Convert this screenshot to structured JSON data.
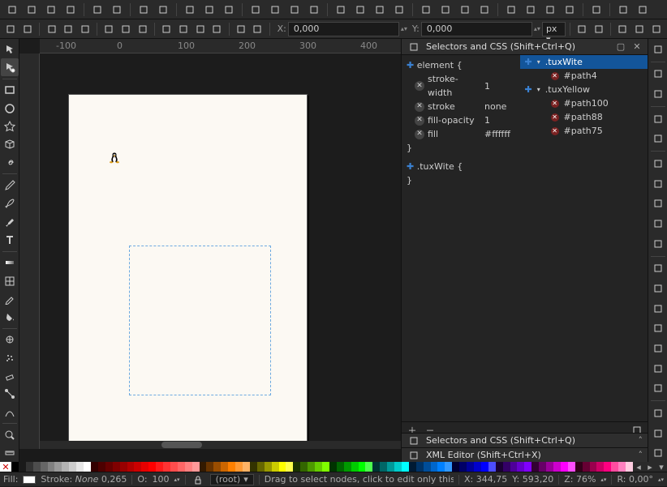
{
  "toolbar1": {
    "groups": [
      [
        "new-document-icon",
        "open-icon",
        "save-icon",
        "print-icon"
      ],
      [
        "import-icon",
        "export-icon"
      ],
      [
        "undo-icon",
        "redo-icon"
      ],
      [
        "copy-icon",
        "cut-icon",
        "paste-icon"
      ],
      [
        "zoom-in-icon",
        "zoom-out-icon",
        "zoom-page-icon",
        "zoom-selection-icon"
      ],
      [
        "duplicate-icon",
        "clone-icon",
        "unlink-icon",
        "group-icon"
      ],
      [
        "snap-node-icon",
        "snap-path-icon",
        "snap-bound-icon",
        "snap-page-icon"
      ],
      [
        "text-tool-icon",
        "text-flow-icon",
        "text-kern-icon",
        "text-path-icon"
      ],
      [
        "align-dialog-icon"
      ],
      [
        "doc-properties-icon",
        "preferences-icon"
      ]
    ]
  },
  "toolbar2": {
    "node_ops": [
      "add-node-icon",
      "delete-node-icon",
      "break-node-icon",
      "join-node-icon",
      "corner-node-icon",
      "smooth-node-icon",
      "symmetric-node-icon",
      "auto-node-icon",
      "line-segment-icon",
      "curve-segment-icon",
      "object-to-path-icon",
      "flatten-icon",
      "x-scale-icon",
      "y-scale-icon"
    ],
    "x_label": "X:",
    "x_value": "0,000",
    "y_label": "Y:",
    "y_value": "0,000",
    "unit": "px",
    "end": [
      "next-path-icon",
      "prev-path-icon",
      "show-handles-icon",
      "show-outline-icon",
      "snap-nodes-icon"
    ]
  },
  "ruler_ticks": [
    "-100",
    "0",
    "100",
    "200",
    "300",
    "400"
  ],
  "tools_left": [
    {
      "n": "selector-tool-icon",
      "svg": "arrow"
    },
    {
      "n": "node-tool-icon",
      "svg": "node",
      "active": true
    },
    {
      "sep": true
    },
    {
      "n": "rectangle-tool-icon",
      "svg": "rect"
    },
    {
      "n": "ellipse-tool-icon",
      "svg": "circle"
    },
    {
      "n": "star-tool-icon",
      "svg": "star"
    },
    {
      "n": "box3d-tool-icon",
      "svg": "cube"
    },
    {
      "n": "spiral-tool-icon",
      "svg": "spiral"
    },
    {
      "sep": true
    },
    {
      "n": "pencil-tool-icon",
      "svg": "pencil"
    },
    {
      "n": "bezier-tool-icon",
      "svg": "pen"
    },
    {
      "n": "calligraphy-tool-icon",
      "svg": "brush"
    },
    {
      "n": "text-tool-icon",
      "svg": "text"
    },
    {
      "sep": true
    },
    {
      "n": "gradient-tool-icon",
      "svg": "grad"
    },
    {
      "n": "mesh-tool-icon",
      "svg": "mesh"
    },
    {
      "n": "dropper-tool-icon",
      "svg": "dropper"
    },
    {
      "n": "bucket-tool-icon",
      "svg": "bucket"
    },
    {
      "sep": true
    },
    {
      "n": "tweak-tool-icon",
      "svg": "tweak"
    },
    {
      "n": "spray-tool-icon",
      "svg": "spray"
    },
    {
      "n": "eraser-tool-icon",
      "svg": "eraser"
    },
    {
      "n": "connector-tool-icon",
      "svg": "connector"
    },
    {
      "n": "lpe-tool-icon",
      "svg": "lpe"
    },
    {
      "sep": true
    },
    {
      "n": "zoom-tool-icon",
      "svg": "zoom"
    },
    {
      "n": "measure-tool-icon",
      "svg": "measure"
    }
  ],
  "tools_right": [
    "rotate-cw-icon",
    "",
    "view-normal-icon",
    "view-outline-icon",
    "",
    "grid-icon",
    "guides-icon",
    "",
    "snap-enable-icon",
    "snap-bbox-icon",
    "snap-edge-icon",
    "snap-corner-icon",
    "snap-center-icon",
    "",
    "snap-node-edit-icon",
    "snap-cusp-icon",
    "snap-smooth-icon",
    "snap-intersection-icon",
    "snap-midpoint-icon",
    "snap-object-center-icon",
    "snap-text-baseline-icon",
    "",
    "snap-page-border-icon",
    "snap-grid-line-icon",
    "snap-guide-icon"
  ],
  "panel": {
    "title": "Selectors and CSS (Shift+Ctrl+Q)",
    "rules": {
      "open0": "element {",
      "props": [
        {
          "prop": "stroke-width",
          "val": "1"
        },
        {
          "prop": "stroke",
          "val": "none"
        },
        {
          "prop": "fill-opacity",
          "val": "1"
        },
        {
          "prop": "fill",
          "val": "#ffffff"
        }
      ],
      "close0": "}",
      "open1": ".tuxWite {",
      "close1": "}"
    },
    "selectors": [
      {
        "kind": "class",
        "label": ".tuxWite",
        "active": true
      },
      {
        "kind": "id",
        "label": "#path4"
      },
      {
        "kind": "class",
        "label": ".tuxYellow"
      },
      {
        "kind": "id",
        "label": "#path100"
      },
      {
        "kind": "id",
        "label": "#path88"
      },
      {
        "kind": "id",
        "label": "#path75"
      }
    ]
  },
  "collapsed": [
    {
      "title": "Selectors and CSS (Shift+Ctrl+Q)"
    },
    {
      "title": "XML Editor (Shift+Ctrl+X)"
    }
  ],
  "palette": [
    "#000000",
    "#1a1a1a",
    "#333333",
    "#4d4d4d",
    "#666666",
    "#808080",
    "#999999",
    "#b3b3b3",
    "#cccccc",
    "#e6e6e6",
    "#ffffff",
    "#330000",
    "#4d0000",
    "#660000",
    "#800000",
    "#990000",
    "#b30000",
    "#cc0000",
    "#e60000",
    "#ff0000",
    "#ff1a1a",
    "#ff3333",
    "#ff4d4d",
    "#ff6666",
    "#ff8080",
    "#ff9999",
    "#331a00",
    "#663300",
    "#994d00",
    "#cc6600",
    "#ff8000",
    "#ff9933",
    "#ffb366",
    "#333300",
    "#666600",
    "#999900",
    "#cccc00",
    "#ffff00",
    "#ffff4d",
    "#1a3300",
    "#336600",
    "#4d9900",
    "#66cc00",
    "#80ff00",
    "#003300",
    "#006600",
    "#009900",
    "#00cc00",
    "#00ff00",
    "#4dff4d",
    "#003333",
    "#006666",
    "#009999",
    "#00cccc",
    "#00ffff",
    "#001a33",
    "#003366",
    "#004d99",
    "#0066cc",
    "#0080ff",
    "#3399ff",
    "#000033",
    "#000066",
    "#000099",
    "#0000cc",
    "#0000ff",
    "#4d4dff",
    "#1a0033",
    "#330066",
    "#4d0099",
    "#6600cc",
    "#8000ff",
    "#330033",
    "#660066",
    "#990099",
    "#cc00cc",
    "#ff00ff",
    "#ff4dff",
    "#33001a",
    "#660033",
    "#99004d",
    "#cc0066",
    "#ff0080",
    "#ff4da0",
    "#ff80bf",
    "#ffcce0"
  ],
  "status": {
    "fill_label": "Fill:",
    "stroke_label": "Stroke:",
    "stroke_value": "None",
    "stroke_w": "0,265",
    "opacity_label": "O:",
    "opacity": "100",
    "layer": "(root)",
    "hint": "Drag to select nodes, click to edit only this object",
    "x_label": "X:",
    "x": "344,75",
    "y_label": "Y:",
    "y": "593,20",
    "z_label": "Z:",
    "z": "76%",
    "r_label": "R:",
    "r": "0,00°"
  }
}
